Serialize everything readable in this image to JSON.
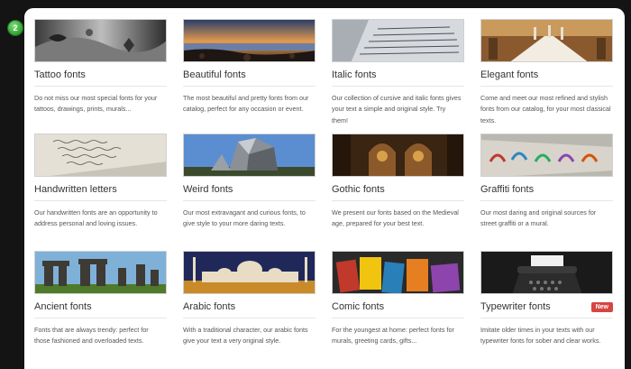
{
  "step_badge": "2",
  "cards": [
    {
      "title": "Tattoo fonts",
      "desc": "Do not miss our most special fonts for your tattoos, drawings, prints, murals...",
      "image_icon": "tattoo-image"
    },
    {
      "title": "Beautiful fonts",
      "desc": "The most beautiful and pretty fonts from our catalog, perfect for any occasion or event.",
      "image_icon": "sunset-coast-image"
    },
    {
      "title": "Italic fonts",
      "desc": "Our collection of cursive and italic fonts gives your text a simple and original style. Try them!",
      "image_icon": "handwritten-pages-image"
    },
    {
      "title": "Elegant fonts",
      "desc": "Come and meet our most refined and stylish fonts from our catalog, for your most classical texts.",
      "image_icon": "banquet-table-image"
    },
    {
      "title": "Handwritten letters",
      "desc": "Our handwritten fonts are an opportunity to address personal and loving issues.",
      "image_icon": "old-letter-image"
    },
    {
      "title": "Weird fonts",
      "desc": "Our most extravagant and curious fonts, to give style to your more daring texts.",
      "image_icon": "futuristic-building-image"
    },
    {
      "title": "Gothic fonts",
      "desc": "We present our fonts based on the Medieval age, prepared for your best text.",
      "image_icon": "cathedral-image"
    },
    {
      "title": "Graffiti fonts",
      "desc": "Our most daring and original sources for street graffiti or a mural.",
      "image_icon": "graffiti-wall-image"
    },
    {
      "title": "Ancient fonts",
      "desc": "Fonts that are always trendy: perfect for those fashioned and overloaded texts.",
      "image_icon": "stonehenge-image"
    },
    {
      "title": "Arabic fonts",
      "desc": "With a traditional character, our arabic fonts give your text a very original style.",
      "image_icon": "mosque-image"
    },
    {
      "title": "Comic fonts",
      "desc": "For the youngest at home: perfect fonts for murals, greeting cards, gifts...",
      "image_icon": "comic-books-image"
    },
    {
      "title": "Typewriter fonts",
      "desc": "Imitate older times in your texts with our typewriter fonts for sober and clear works.",
      "image_icon": "typewriter-image",
      "badge": "New"
    }
  ],
  "colors": {
    "new_badge": "#d64541",
    "step_badge": "#2f9e2f"
  }
}
